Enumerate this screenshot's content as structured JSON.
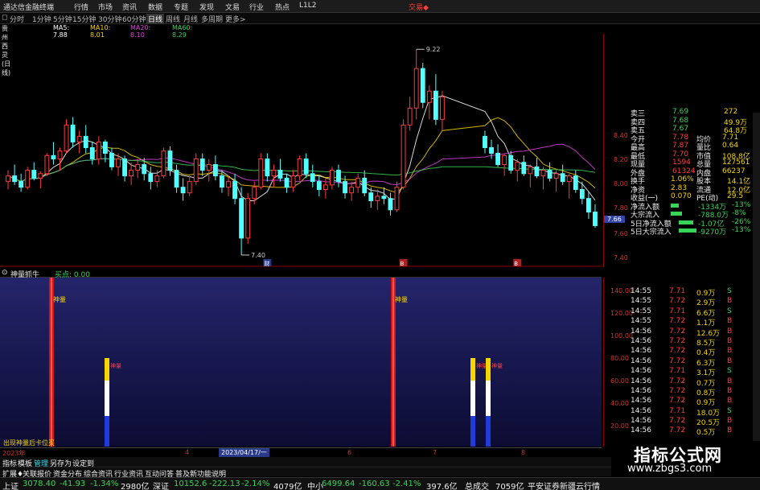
{
  "window": {
    "title": "通达信金融终端",
    "menu": [
      "行情",
      "市场",
      "资讯",
      "数据",
      "专题",
      "发现",
      "文易",
      "行业",
      "热点",
      "L1L2"
    ],
    "trade_label": "交易◆"
  },
  "periods": [
    "分时",
    "1分钟",
    "5分钟",
    "15分钟",
    "30分钟",
    "60分钟",
    "日线",
    "周线",
    "月线",
    "多周期",
    "更多>"
  ],
  "active_period": "日线",
  "ma_legend": {
    "stock": "贵州西灵(日线)",
    "items": [
      {
        "label": "MA5: 7.88",
        "color": "#ffffff"
      },
      {
        "label": "MA10: 8.01",
        "color": "#f5d500"
      },
      {
        "label": "MA20: 8.10",
        "color": "#e040e0"
      },
      {
        "label": "MA60: 8.29",
        "color": "#39d35a"
      }
    ]
  },
  "price_chart": {
    "high_label": "9.22",
    "low_label": "7.40",
    "marker_labels": [
      "财",
      "B",
      "B"
    ],
    "price_axis": [
      "8.40",
      "8.20",
      "8.00",
      "7.80",
      "7.60",
      "7.40"
    ],
    "current_price_tag": "7.66",
    "candles": [
      [
        8.05,
        8.15,
        7.98,
        8.1
      ],
      [
        8.1,
        8.2,
        8.02,
        8.05
      ],
      [
        8.05,
        8.12,
        7.96,
        8.0
      ],
      [
        8.0,
        8.18,
        7.98,
        8.15
      ],
      [
        8.15,
        8.22,
        8.06,
        8.08
      ],
      [
        8.08,
        8.14,
        7.99,
        8.12
      ],
      [
        8.12,
        8.3,
        8.1,
        8.28
      ],
      [
        8.28,
        8.4,
        8.2,
        8.25
      ],
      [
        8.25,
        8.35,
        8.15,
        8.32
      ],
      [
        8.32,
        8.6,
        8.3,
        8.55
      ],
      [
        8.55,
        8.62,
        8.35,
        8.4
      ],
      [
        8.4,
        8.5,
        8.3,
        8.45
      ],
      [
        8.45,
        8.55,
        8.3,
        8.35
      ],
      [
        8.35,
        8.4,
        8.2,
        8.25
      ],
      [
        8.25,
        8.45,
        8.2,
        8.4
      ],
      [
        8.4,
        8.42,
        8.22,
        8.3
      ],
      [
        8.3,
        8.35,
        8.15,
        8.18
      ],
      [
        8.18,
        8.3,
        8.1,
        8.25
      ],
      [
        8.25,
        8.28,
        8.05,
        8.1
      ],
      [
        8.1,
        8.22,
        8.02,
        8.15
      ],
      [
        8.15,
        8.25,
        8.08,
        8.2
      ],
      [
        8.2,
        8.26,
        8.06,
        8.12
      ],
      [
        8.12,
        8.18,
        7.98,
        8.05
      ],
      [
        8.05,
        8.15,
        8.0,
        8.1
      ],
      [
        8.1,
        8.35,
        8.08,
        8.32
      ],
      [
        8.32,
        8.36,
        8.1,
        8.15
      ],
      [
        8.15,
        8.2,
        7.95,
        8.0
      ],
      [
        8.0,
        8.08,
        7.88,
        7.95
      ],
      [
        7.95,
        8.1,
        7.92,
        8.05
      ],
      [
        8.05,
        8.3,
        8.02,
        8.25
      ],
      [
        8.25,
        8.3,
        8.1,
        8.15
      ],
      [
        8.15,
        8.25,
        8.05,
        8.2
      ],
      [
        8.2,
        8.28,
        8.06,
        8.1
      ],
      [
        8.1,
        8.15,
        7.95,
        8.0
      ],
      [
        8.0,
        8.1,
        7.92,
        8.05
      ],
      [
        8.05,
        8.12,
        7.85,
        7.9
      ],
      [
        7.9,
        8.0,
        7.4,
        7.55
      ],
      [
        7.55,
        7.95,
        7.5,
        7.9
      ],
      [
        7.9,
        8.05,
        7.85,
        8.0
      ],
      [
        8.0,
        8.3,
        7.98,
        8.25
      ],
      [
        8.25,
        8.3,
        8.05,
        8.1
      ],
      [
        8.1,
        8.2,
        8.0,
        8.15
      ],
      [
        8.15,
        8.25,
        8.05,
        8.08
      ],
      [
        8.08,
        8.12,
        7.95,
        8.0
      ],
      [
        8.0,
        8.15,
        7.96,
        8.1
      ],
      [
        8.1,
        8.28,
        8.06,
        8.25
      ],
      [
        8.25,
        8.3,
        8.08,
        8.12
      ],
      [
        8.12,
        8.2,
        8.0,
        8.05
      ],
      [
        8.05,
        8.1,
        7.92,
        7.98
      ],
      [
        7.98,
        8.08,
        7.9,
        8.02
      ],
      [
        8.02,
        8.18,
        7.98,
        8.15
      ],
      [
        8.15,
        8.2,
        8.0,
        8.05
      ],
      [
        8.05,
        8.1,
        7.9,
        7.95
      ],
      [
        7.95,
        8.05,
        7.88,
        8.0
      ],
      [
        8.0,
        8.12,
        7.95,
        8.08
      ],
      [
        8.08,
        8.15,
        7.92,
        7.95
      ],
      [
        7.95,
        8.0,
        7.82,
        7.88
      ],
      [
        7.88,
        7.98,
        7.8,
        7.92
      ],
      [
        7.92,
        8.0,
        7.85,
        7.9
      ],
      [
        7.9,
        7.95,
        7.75,
        7.8
      ],
      [
        7.8,
        8.05,
        7.78,
        8.0
      ],
      [
        8.0,
        8.6,
        7.98,
        8.55
      ],
      [
        8.55,
        8.8,
        8.5,
        8.7
      ],
      [
        8.7,
        9.22,
        8.6,
        9.05
      ],
      [
        9.05,
        9.1,
        8.7,
        8.75
      ],
      [
        8.75,
        8.9,
        8.6,
        8.85
      ],
      [
        8.85,
        9.0,
        8.55,
        8.6
      ],
      [
        8.6,
        8.85,
        8.5,
        8.8
      ],
      [
        8.45,
        8.5,
        8.3,
        8.35
      ],
      [
        8.35,
        8.42,
        8.25,
        8.3
      ],
      [
        8.3,
        8.38,
        8.18,
        8.2
      ],
      [
        8.2,
        8.3,
        8.1,
        8.28
      ],
      [
        8.28,
        8.32,
        8.12,
        8.15
      ],
      [
        8.15,
        8.25,
        8.05,
        8.22
      ],
      [
        8.22,
        8.28,
        8.1,
        8.12
      ],
      [
        8.12,
        8.2,
        8.0,
        8.18
      ],
      [
        8.18,
        8.26,
        8.08,
        8.1
      ],
      [
        8.1,
        8.18,
        7.98,
        8.15
      ],
      [
        8.15,
        8.22,
        8.05,
        8.08
      ],
      [
        8.08,
        8.15,
        7.96,
        8.12
      ],
      [
        8.12,
        8.2,
        8.02,
        8.05
      ],
      [
        8.05,
        8.12,
        7.9,
        8.1
      ],
      [
        8.1,
        8.15,
        7.95,
        7.98
      ],
      [
        7.98,
        8.05,
        7.85,
        7.9
      ],
      [
        7.9,
        7.96,
        7.72,
        7.78
      ],
      [
        7.78,
        7.85,
        7.64,
        7.66
      ]
    ]
  },
  "indicator": {
    "name": "神量抓牛",
    "value_label": "买点: 0.00",
    "signal_label": "神量",
    "bar_label": "神量",
    "axis": [
      "140.00",
      "120.00",
      "100.00",
      "80.00",
      "60.00",
      "40.00",
      "20.00"
    ],
    "bottom_note": "出现神量后卡位买",
    "signals": [
      1,
      0,
      0,
      0,
      0,
      0,
      0,
      0,
      0,
      0,
      0,
      0,
      0,
      0,
      0,
      0,
      0,
      0,
      0,
      0,
      0,
      0,
      0,
      0,
      0,
      0,
      0,
      0,
      0,
      0,
      0,
      0,
      0,
      0,
      0,
      0,
      0,
      0,
      0,
      0,
      0,
      0,
      0,
      0,
      0,
      0,
      0,
      0,
      0,
      0,
      0,
      0,
      0,
      0,
      0,
      0,
      0,
      0,
      0,
      0,
      0,
      0,
      0,
      0,
      0,
      0,
      0,
      0
    ]
  },
  "date_axis": {
    "year": "2023年",
    "months": [
      "4",
      "5",
      "6",
      "7",
      "8"
    ],
    "cursor_date": "2023/04/17/一"
  },
  "quote_panel": {
    "asks": [
      {
        "label": "卖三",
        "price": "7.69",
        "vol": "272"
      },
      {
        "label": "卖四",
        "price": "7.68",
        "vol": "49.9万"
      },
      {
        "label": "卖五",
        "price": "7.67",
        "vol": "64.8万"
      }
    ],
    "stats": [
      {
        "l1": "今开",
        "v1": "7.78",
        "l2": "均价",
        "v2": "7.71"
      },
      {
        "l1": "最高",
        "v1": "7.87",
        "l2": "量比",
        "v2": "0.64"
      },
      {
        "l1": "最低",
        "v1": "7.70",
        "l2": "市值",
        "v2": "108.8亿"
      },
      {
        "l1": "现量",
        "v1": "1594",
        "l2": "总量",
        "v2": "127561"
      },
      {
        "l1": "外盘",
        "v1": "61324",
        "l2": "内盘",
        "v2": "66237"
      }
    ],
    "stats2": [
      {
        "l1": "换手",
        "v1": "1.06%",
        "l2": "股本",
        "v2": "14.1亿"
      },
      {
        "l1": "净资",
        "v1": "2.83",
        "l2": "流通",
        "v2": "12.0亿"
      },
      {
        "l1": "收益(一)",
        "v1": "0.070",
        "l2": "PE(动)",
        "v2": "29.5"
      }
    ],
    "flows": [
      {
        "label": "净流入额",
        "value": "-1334万",
        "pct": "-13%"
      },
      {
        "label": "大宗流入",
        "value": "-788.0万",
        "pct": "-8%"
      },
      {
        "label": "5日净流入额",
        "value": "-1.07亿",
        "pct": "-26%"
      },
      {
        "label": "5日大宗流入",
        "value": "-9270万",
        "pct": "-13%"
      }
    ],
    "ticks": [
      {
        "t": "14:55",
        "p": "7.71",
        "v": "0.9万",
        "s": "S"
      },
      {
        "t": "14:55",
        "p": "7.72",
        "v": "2.9万",
        "s": "B"
      },
      {
        "t": "14:55",
        "p": "7.71",
        "v": "6.6万",
        "s": "S"
      },
      {
        "t": "14:55",
        "p": "7.72",
        "v": "1.1万",
        "s": "B"
      },
      {
        "t": "14:56",
        "p": "7.72",
        "v": "12.6万",
        "s": "B"
      },
      {
        "t": "14:56",
        "p": "7.72",
        "v": "8.5万",
        "s": "B"
      },
      {
        "t": "14:56",
        "p": "7.72",
        "v": "0.4万",
        "s": "B"
      },
      {
        "t": "14:56",
        "p": "7.72",
        "v": "6.3万",
        "s": "B"
      },
      {
        "t": "14:56",
        "p": "7.71",
        "v": "3.1万",
        "s": "S"
      },
      {
        "t": "14:56",
        "p": "7.72",
        "v": "0.7万",
        "s": "B"
      },
      {
        "t": "14:56",
        "p": "7.72",
        "v": "0.8万",
        "s": "B"
      },
      {
        "t": "14:56",
        "p": "7.72",
        "v": "0.9万",
        "s": "B"
      },
      {
        "t": "14:56",
        "p": "7.71",
        "v": "18.0万",
        "s": "S"
      },
      {
        "t": "14:56",
        "p": "7.72",
        "v": "20.5万",
        "s": "B"
      },
      {
        "t": "14:56",
        "p": "7.72",
        "v": "0.5万",
        "s": "B"
      }
    ]
  },
  "bottom_tabs": [
    "指标",
    "模板",
    "管理",
    "另存为",
    "设定到"
  ],
  "bottom_tabs2": [
    "扩展♦",
    "关联报价",
    "资金分布",
    "综合资讯",
    "行业资讯",
    "互动问答",
    "普及新功能说明"
  ],
  "ticker": [
    {
      "name": "上证",
      "price": "3078.40",
      "chg": "-41.93",
      "pct": "-1.34%",
      "amt": "2980亿"
    },
    {
      "name": "深证",
      "price": "10152.6",
      "chg": "-222.13",
      "pct": "-2.14%",
      "amt": "4079亿"
    },
    {
      "name": "中小",
      "price": "6499.64",
      "chg": "-160.63",
      "pct": "-2.41%",
      "amt": "397.6亿"
    }
  ],
  "ticker_total": {
    "label": "总成交",
    "value": "7059亿"
  },
  "broker_note": "平安证券新疆云行情",
  "watermark": {
    "line1": "指标公式网",
    "line2": "www.zbgs3.com"
  }
}
